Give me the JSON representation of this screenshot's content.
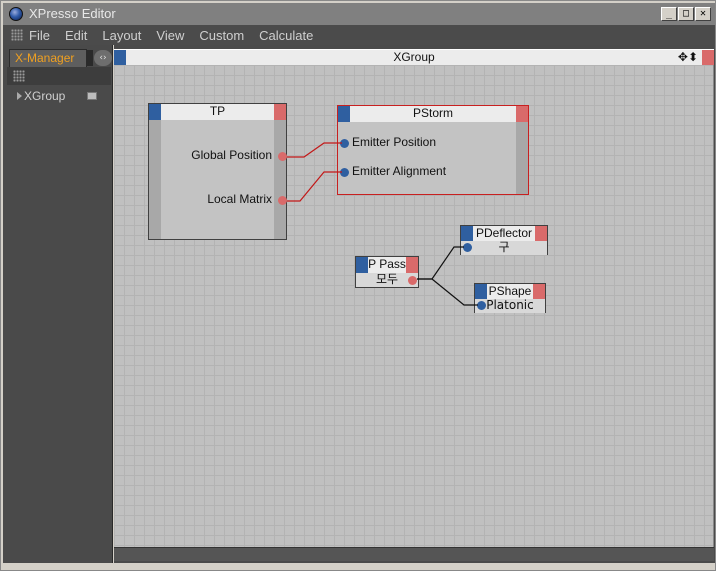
{
  "window": {
    "title": "XPresso Editor",
    "buttons": {
      "minimize": "_",
      "maximize": "□",
      "close": "✕"
    }
  },
  "menubar": {
    "items": [
      "File",
      "Edit",
      "Layout",
      "View",
      "Custom",
      "Calculate"
    ]
  },
  "left_panel": {
    "tab_label": "X-Manager",
    "tab_arrows": "‹›",
    "tree": [
      {
        "label": "XGroup"
      }
    ]
  },
  "canvas": {
    "group_title": "XGroup",
    "header_icons": "✥⬍"
  },
  "nodes": {
    "tp": {
      "name": "TP",
      "outputs": [
        "Global Position",
        "Local Matrix"
      ]
    },
    "pstorm": {
      "name": "PStorm",
      "inputs": [
        "Emitter Position",
        "Emitter Alignment"
      ]
    },
    "ppass": {
      "name": "P Pass",
      "value": "모두"
    },
    "pdeflector": {
      "name": "PDeflector",
      "value": "구"
    },
    "pshape": {
      "name": "PShape",
      "value": "Platonic"
    }
  },
  "colors": {
    "input_port": "#2f5fa0",
    "output_port": "#d96a6a",
    "selection": "#c82020",
    "accent_tab": "#f0a020"
  }
}
